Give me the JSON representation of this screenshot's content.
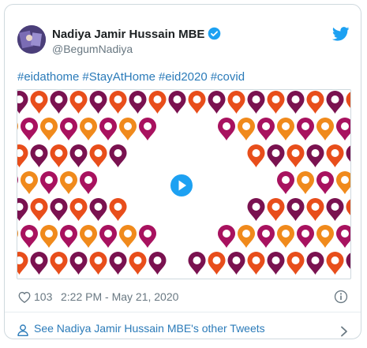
{
  "author": {
    "name": "Nadiya Jamir Hussain MBE",
    "handle": "@BegumNadiya",
    "verified": true
  },
  "tweet": {
    "hashtags": [
      "#eidathome",
      "#StayAtHome",
      "#eid2020",
      "#covid"
    ]
  },
  "media": {
    "type": "video",
    "colors": [
      "#a8125f",
      "#e84e1b",
      "#f08a1c",
      "#7a1250"
    ]
  },
  "meta": {
    "like_count": "103",
    "timestamp": "2:22 PM - May 21, 2020"
  },
  "footer": {
    "label": "See Nadiya Jamir Hussain MBE's other Tweets"
  },
  "colors": {
    "link": "#2b7bb9",
    "twitter_blue": "#1da1f2",
    "muted": "#697882"
  }
}
